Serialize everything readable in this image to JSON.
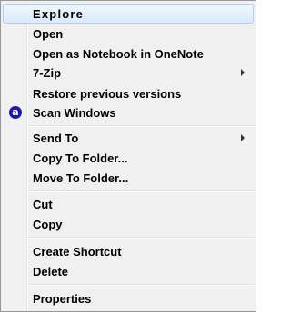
{
  "menu": {
    "items": [
      {
        "label": "Explore"
      },
      {
        "label": "Open"
      },
      {
        "label": "Open as Notebook in OneNote"
      },
      {
        "label": "7-Zip"
      },
      {
        "label": "Restore previous versions"
      },
      {
        "label": "Scan Windows",
        "icon": "antivirus-a-icon",
        "icon_text": "a"
      },
      {
        "label": "Send To"
      },
      {
        "label": "Copy To Folder..."
      },
      {
        "label": "Move To Folder..."
      },
      {
        "label": "Cut"
      },
      {
        "label": "Copy"
      },
      {
        "label": "Create Shortcut"
      },
      {
        "label": "Delete"
      },
      {
        "label": "Properties"
      }
    ]
  },
  "colors": {
    "highlight": "#dae9fb",
    "highlight_border": "#aecff7",
    "background": "#f0f0f0",
    "icon_blue": "#1a1aa8"
  }
}
